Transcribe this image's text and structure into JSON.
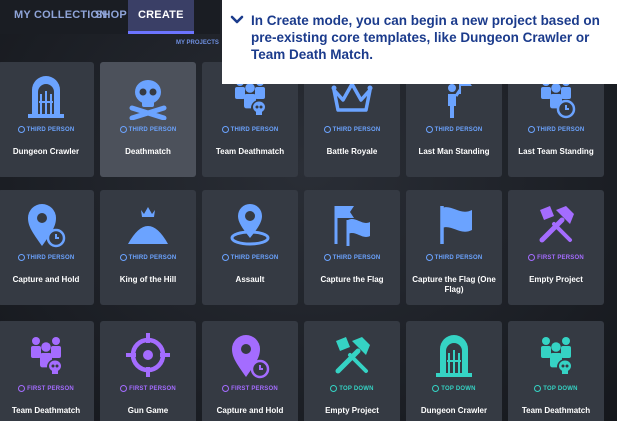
{
  "nav": {
    "tabs": [
      {
        "label": "MY COLLECTION"
      },
      {
        "label": "SHOP"
      },
      {
        "label": "CREATE"
      }
    ],
    "my_projects": "MY PROJECTS"
  },
  "tooltip": {
    "text": "In Create mode, you can begin a new project based on pre-existing core templates, like Dungeon Crawler or Team Death Match."
  },
  "colors": {
    "third_person": "#6ba3ff",
    "first_person": "#a46cff",
    "top_down": "#35d3c4",
    "tooltip_text": "#1b3b8c"
  },
  "templates": [
    {
      "name": "Dungeon Crawler",
      "mode": "THIRD PERSON",
      "icon": "dungeon-gate-icon"
    },
    {
      "name": "Deathmatch",
      "mode": "THIRD PERSON",
      "icon": "skull-crossbones-icon"
    },
    {
      "name": "Team Deathmatch",
      "mode": "THIRD PERSON",
      "icon": "team-skull-icon"
    },
    {
      "name": "Battle Royale",
      "mode": "THIRD PERSON",
      "icon": "crown-icon"
    },
    {
      "name": "Last Man Standing",
      "mode": "THIRD PERSON",
      "icon": "figure-flag-icon"
    },
    {
      "name": "Last Team Standing",
      "mode": "THIRD PERSON",
      "icon": "team-clock-icon"
    },
    {
      "name": "Capture and Hold",
      "mode": "THIRD PERSON",
      "icon": "pin-clock-icon"
    },
    {
      "name": "King of the Hill",
      "mode": "THIRD PERSON",
      "icon": "hill-crown-icon"
    },
    {
      "name": "Assault",
      "mode": "THIRD PERSON",
      "icon": "target-pin-icon"
    },
    {
      "name": "Capture the Flag",
      "mode": "THIRD PERSON",
      "icon": "two-flags-icon"
    },
    {
      "name": "Capture the Flag (One Flag)",
      "mode": "THIRD PERSON",
      "icon": "one-flag-icon"
    },
    {
      "name": "Empty Project",
      "mode": "FIRST PERSON",
      "icon": "hammer-brush-icon"
    },
    {
      "name": "Team Deathmatch",
      "mode": "FIRST PERSON",
      "icon": "team-skull-icon"
    },
    {
      "name": "Gun Game",
      "mode": "FIRST PERSON",
      "icon": "crosshair-icon"
    },
    {
      "name": "Capture and Hold",
      "mode": "FIRST PERSON",
      "icon": "pin-clock-icon"
    },
    {
      "name": "Empty Project",
      "mode": "TOP DOWN",
      "icon": "hammer-brush-icon"
    },
    {
      "name": "Dungeon Crawler",
      "mode": "TOP DOWN",
      "icon": "dungeon-gate-icon"
    },
    {
      "name": "Team Deathmatch",
      "mode": "TOP DOWN",
      "icon": "team-skull-icon"
    }
  ]
}
